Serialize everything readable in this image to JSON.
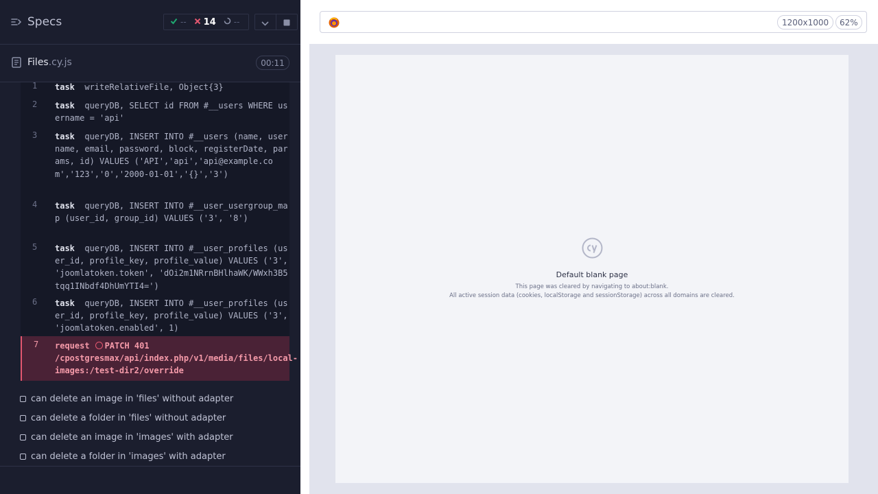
{
  "header": {
    "specs_label": "Specs",
    "stats": {
      "passed": "--",
      "failed": "14",
      "pending": "--"
    }
  },
  "file": {
    "base": "Files",
    "ext": ".cy.js",
    "duration": "00:11"
  },
  "commands": [
    {
      "num": "1",
      "keyword": "task",
      "message": "writeRelativeFile, Object{3}"
    },
    {
      "num": "2",
      "keyword": "task",
      "message": "queryDB, SELECT id FROM #__users WHERE username = 'api'"
    },
    {
      "num": "3",
      "keyword": "task",
      "message": "queryDB, INSERT INTO #__users (name, username, email, password, block, registerDate, params, id) VALUES ('API','api','api@example.com','123','0','2000-01-01','{}','3')"
    },
    {
      "num": "4",
      "keyword": "task",
      "message": "queryDB, INSERT INTO #__user_usergroup_map (user_id, group_id) VALUES ('3', '8')"
    },
    {
      "num": "5",
      "keyword": "task",
      "message": "queryDB, INSERT INTO #__user_profiles (user_id, profile_key, profile_value) VALUES ('3', 'joomlatoken.token', 'dOi2m1NRrnBHlhaWK/WWxh3B5tqq1INbdf4DhUmYTI4=')"
    },
    {
      "num": "6",
      "keyword": "task",
      "message": "queryDB, INSERT INTO #__user_profiles (user_id, profile_key, profile_value) VALUES ('3', 'joomlatoken.enabled', 1)"
    }
  ],
  "failed_command": {
    "num": "7",
    "keyword": "request",
    "message": "PATCH 401 /cpostgresmax/api/index.php/v1/media/files/local-images:/test-dir2/override"
  },
  "tests": [
    "can delete an image in 'files' without adapter",
    "can delete a folder in 'files' without adapter",
    "can delete an image in 'images' with adapter",
    "can delete a folder in 'images' with adapter"
  ],
  "browser": {
    "viewport": "1200x1000",
    "zoom": "62%"
  },
  "blank_page": {
    "title": "Default blank page",
    "line1": "This page was cleared by navigating to about:blank.",
    "line2": "All active session data (cookies, localStorage and sessionStorage) across all domains are cleared."
  },
  "colors": {
    "fail": "#e45770",
    "pass": "#1fa971",
    "panel": "#1b1e2e"
  }
}
